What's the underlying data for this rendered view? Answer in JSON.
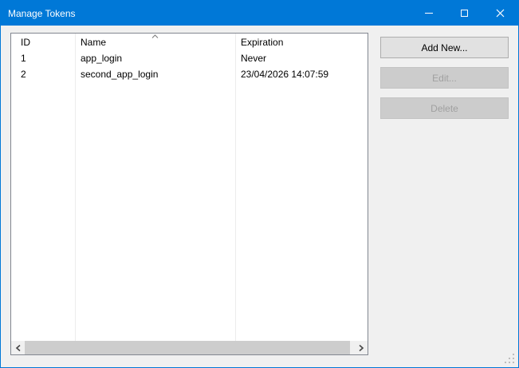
{
  "window": {
    "title": "Manage Tokens",
    "caption_buttons": {
      "minimize": "minimize",
      "maximize": "maximize",
      "close": "close"
    }
  },
  "table": {
    "columns": [
      {
        "label": "ID",
        "sort": null
      },
      {
        "label": "Name",
        "sort": "ascending"
      },
      {
        "label": "Expiration",
        "sort": null
      }
    ],
    "rows": [
      {
        "id": "1",
        "name": "app_login",
        "expiration": "Never"
      },
      {
        "id": "2",
        "name": "second_app_login",
        "expiration": "23/04/2026 14:07:59"
      }
    ]
  },
  "actions": {
    "add_new": {
      "label": "Add New...",
      "enabled": true
    },
    "edit": {
      "label": "Edit...",
      "enabled": false
    },
    "delete": {
      "label": "Delete",
      "enabled": false
    }
  },
  "scrollbar": {
    "orientation": "horizontal"
  },
  "colors": {
    "accent": "#0078d7",
    "titlebar_bg": "#0078d7",
    "titlebar_text": "#ffffff",
    "client_bg": "#f0f0f0",
    "list_border": "#828790",
    "list_bg": "#ffffff",
    "button_bg": "#e1e1e1",
    "button_border": "#adadad",
    "disabled_button_bg": "#cccccc",
    "disabled_button_text": "#a0a0a0",
    "scrollbar_thumb": "#cdcdcd",
    "scrollbar_track": "#f0f0f0"
  }
}
